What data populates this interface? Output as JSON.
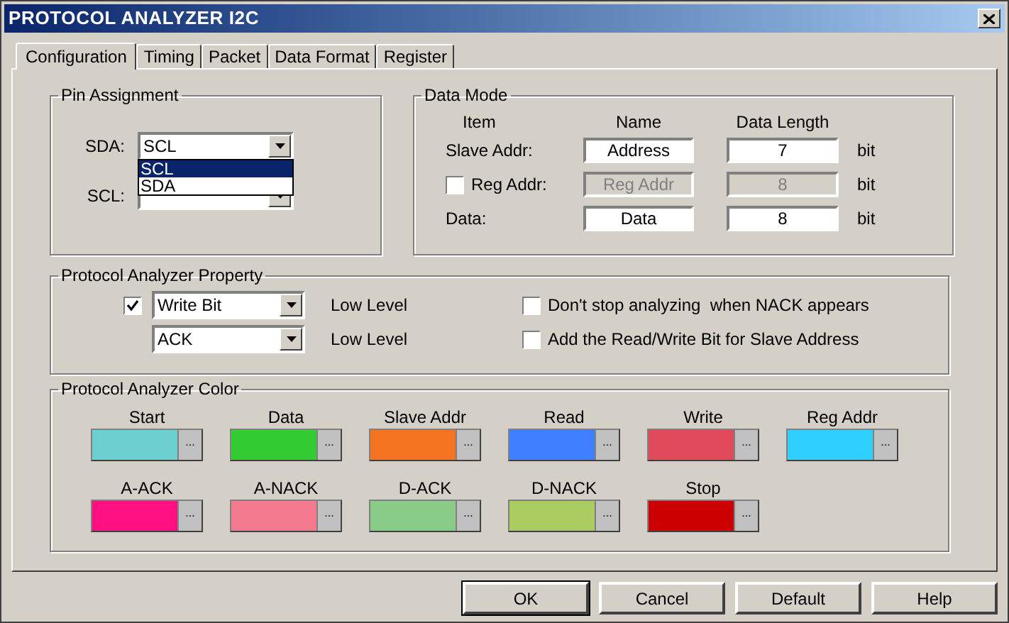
{
  "window": {
    "title": "PROTOCOL ANALYZER I2C"
  },
  "tabs": [
    {
      "label": "Configuration",
      "selected": true
    },
    {
      "label": "Timing",
      "selected": false
    },
    {
      "label": "Packet",
      "selected": false
    },
    {
      "label": "Data Format",
      "selected": false
    },
    {
      "label": "Register",
      "selected": false
    }
  ],
  "pin_assignment": {
    "title": "Pin Assignment",
    "fields": [
      {
        "label": "SDA:",
        "value": "SCL"
      },
      {
        "label": "SCL:"
      }
    ],
    "dropdown_options": [
      {
        "label": "SCL",
        "selected": true
      },
      {
        "label": "SDA",
        "selected": false
      }
    ]
  },
  "data_mode": {
    "title": "Data Mode",
    "headers": [
      "Item",
      "Name",
      "Data Length"
    ],
    "rows": [
      {
        "kind": "plain",
        "label": "Slave Addr:",
        "name": "Address",
        "length": "7",
        "unit": "bit",
        "disabled": false
      },
      {
        "kind": "checkbox",
        "label": "Reg Addr:",
        "checked": false,
        "name": "Reg Addr",
        "length": "8",
        "unit": "bit",
        "disabled": true
      },
      {
        "kind": "plain",
        "label": "Data:",
        "name": "Data",
        "length": "8",
        "unit": "bit",
        "disabled": false
      }
    ]
  },
  "property": {
    "title": "Protocol Analyzer Property",
    "rows": [
      {
        "kind": "checkbox",
        "checked": true,
        "value": "Write Bit",
        "level_text": "Low Level",
        "option": {
          "label": "Don't stop analyzing  when NACK appears",
          "checked": false
        }
      },
      {
        "kind": "plain",
        "value": "ACK",
        "level_text": "Low Level",
        "option": {
          "label": "Add the Read/Write Bit for Slave Address",
          "checked": false
        }
      }
    ]
  },
  "color": {
    "title": "Protocol Analyzer Color",
    "rows": [
      [
        {
          "label": "Start",
          "color": "#6ccfd0",
          "button": "..."
        },
        {
          "label": "Data",
          "color": "#33cc33",
          "button": "..."
        },
        {
          "label": "Slave Addr",
          "color": "#f47320",
          "button": "..."
        },
        {
          "label": "Read",
          "color": "#3f7fff",
          "button": "..."
        },
        {
          "label": "Write",
          "color": "#e04a5a",
          "button": "..."
        },
        {
          "label": "Reg Addr",
          "color": "#2fcfff",
          "button": "..."
        }
      ],
      [
        {
          "label": "A-ACK",
          "color": "#ff0f7f",
          "button": "..."
        },
        {
          "label": "A-NACK",
          "color": "#f47a90",
          "button": "..."
        },
        {
          "label": "D-ACK",
          "color": "#88cc88",
          "button": "..."
        },
        {
          "label": "D-NACK",
          "color": "#aacc60",
          "button": "..."
        },
        {
          "label": "Stop",
          "color": "#cc0000",
          "button": "..."
        }
      ]
    ]
  },
  "buttons": [
    {
      "label": "OK",
      "default": true
    },
    {
      "label": "Cancel",
      "default": false
    },
    {
      "label": "Default",
      "default": false
    },
    {
      "label": "Help",
      "default": false
    }
  ]
}
